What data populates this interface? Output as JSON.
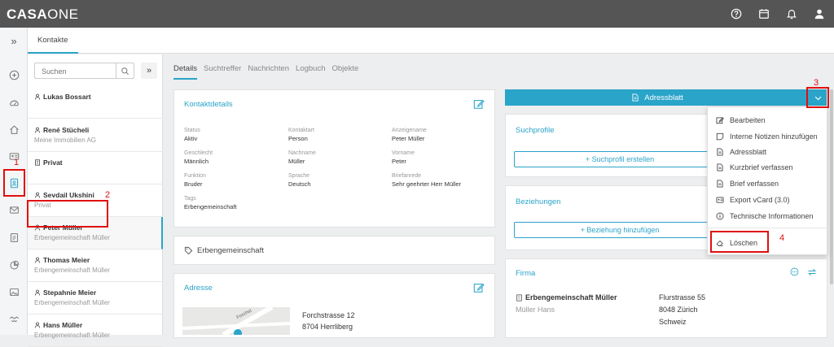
{
  "app": {
    "brand_bold": "CASA",
    "brand_light": "ONE"
  },
  "top_icons": [
    "help-icon",
    "calendar-icon",
    "bell-icon",
    "user-icon"
  ],
  "leftrail": {
    "expand_label": "»"
  },
  "tab": {
    "label": "Kontakte"
  },
  "search": {
    "placeholder": "Suchen",
    "expand_label": "»"
  },
  "contacts": [
    {
      "name": "Lukas Bossart",
      "sub": "",
      "icon": "person-icon"
    },
    {
      "name": "René Stücheli",
      "sub": "Meine Immobilien AG",
      "icon": "person-icon"
    },
    {
      "name": "Privat",
      "sub": "",
      "icon": "building-icon"
    },
    {
      "name": "Sevdail Ukshini",
      "sub": "Privat",
      "icon": "person-icon"
    },
    {
      "name": "Peter Müller",
      "sub": "Erbengemeinschaft Müller",
      "icon": "person-icon"
    },
    {
      "name": "Thomas Meier",
      "sub": "Erbengemeinschaft Müller",
      "icon": "person-icon"
    },
    {
      "name": "Stepahnie Meier",
      "sub": "Erbengemeinschaft Müller",
      "icon": "person-icon"
    },
    {
      "name": "Hans Müller",
      "sub": "Erbengemeinschaft Müller",
      "icon": "person-icon"
    }
  ],
  "detail_tabs": [
    "Details",
    "Suchtreffer",
    "Nachrichten",
    "Logbuch",
    "Objekte"
  ],
  "kontaktdetails": {
    "title": "Kontaktdetails",
    "fields": [
      {
        "label": "Status",
        "value": "Aktiv"
      },
      {
        "label": "Kontaktart",
        "value": "Person"
      },
      {
        "label": "Anzeigename",
        "value": "Peter Müller"
      },
      {
        "label": "Geschlecht",
        "value": "Männlich"
      },
      {
        "label": "Nachname",
        "value": "Müller"
      },
      {
        "label": "Vorname",
        "value": "Peter"
      },
      {
        "label": "Funktion",
        "value": "Bruder"
      },
      {
        "label": "Sprache",
        "value": "Deutsch"
      },
      {
        "label": "Briefanrede",
        "value": "Sehr geehrter Herr Müller"
      },
      {
        "label": "Tags",
        "value": "Erbengemeinschaft"
      }
    ]
  },
  "tag_card": {
    "label": "Erbengemeinschaft"
  },
  "adresse": {
    "title": "Adresse",
    "line1": "Forchstrasse 12",
    "line2": "8704 Herrliberg",
    "map_street": "Forchst"
  },
  "adressblatt_button": "Adressblatt",
  "suchprofile": {
    "title": "Suchprofile",
    "button": "+ Suchprofil erstellen"
  },
  "beziehungen": {
    "title": "Beziehungen",
    "button": "+ Beziehung hinzufügen"
  },
  "firma": {
    "title": "Firma",
    "name": "Erbengemeinschaft Müller",
    "person": "Müller Hans",
    "street": "Flurstrasse 55",
    "city": "8048 Zürich",
    "country": "Schweiz"
  },
  "menu": [
    {
      "label": "Bearbeiten",
      "icon": "edit-icon"
    },
    {
      "label": "Interne Notizen hinzufügen",
      "icon": "note-icon"
    },
    {
      "label": "Adressblatt",
      "icon": "document-icon"
    },
    {
      "label": "Kurzbrief verfassen",
      "icon": "document-icon"
    },
    {
      "label": "Brief verfassen",
      "icon": "document-icon"
    },
    {
      "label": "Export vCard (3.0)",
      "icon": "vcard-icon"
    },
    {
      "label": "Technische Informationen",
      "icon": "info-icon"
    },
    {
      "label": "Löschen",
      "icon": "eraser-icon"
    }
  ],
  "annotations": [
    "1",
    "2",
    "3",
    "4"
  ],
  "colors": {
    "accent": "#2aa4c9",
    "topbar": "#555555",
    "highlight": "#e01010"
  }
}
